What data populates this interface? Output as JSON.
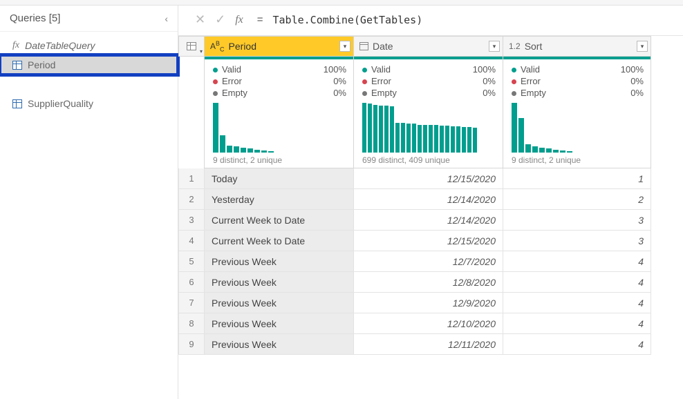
{
  "sidebar": {
    "title": "Queries [5]",
    "items": [
      {
        "label": "DateTableQuery",
        "kind": "fx"
      },
      {
        "label": "Period",
        "kind": "table",
        "selected": true,
        "highlighted": true
      },
      {
        "label": "SupplierQuality",
        "kind": "table"
      }
    ]
  },
  "formula": {
    "eq": "=",
    "text": "Table.Combine(GetTables)"
  },
  "columns": [
    {
      "name": "Period",
      "type": "ABC",
      "selected": true,
      "distinct": "9 distinct, 2 unique"
    },
    {
      "name": "Date",
      "type": "date",
      "distinct": "699 distinct, 409 unique"
    },
    {
      "name": "Sort",
      "type": "1.2",
      "distinct": "9 distinct, 2 unique"
    }
  ],
  "quality": {
    "valid_label": "Valid",
    "valid_pct": "100%",
    "error_label": "Error",
    "error_pct": "0%",
    "empty_label": "Empty",
    "empty_pct": "0%"
  },
  "chart_data": [
    {
      "type": "bar",
      "title": "Period distribution",
      "values": [
        100,
        35,
        14,
        12,
        10,
        8,
        6,
        4,
        3
      ]
    },
    {
      "type": "bar",
      "title": "Date distribution",
      "values": [
        100,
        98,
        96,
        95,
        94,
        93,
        60,
        60,
        58,
        58,
        56,
        56,
        55,
        55,
        54,
        54,
        53,
        53,
        52,
        52,
        50
      ]
    },
    {
      "type": "bar",
      "title": "Sort distribution",
      "values": [
        100,
        70,
        16,
        12,
        10,
        8,
        6,
        4,
        3
      ]
    }
  ],
  "rows": [
    {
      "n": "1",
      "period": "Today",
      "date": "12/15/2020",
      "sort": "1"
    },
    {
      "n": "2",
      "period": "Yesterday",
      "date": "12/14/2020",
      "sort": "2"
    },
    {
      "n": "3",
      "period": "Current Week to Date",
      "date": "12/14/2020",
      "sort": "3"
    },
    {
      "n": "4",
      "period": "Current Week to Date",
      "date": "12/15/2020",
      "sort": "3"
    },
    {
      "n": "5",
      "period": "Previous Week",
      "date": "12/7/2020",
      "sort": "4"
    },
    {
      "n": "6",
      "period": "Previous Week",
      "date": "12/8/2020",
      "sort": "4"
    },
    {
      "n": "7",
      "period": "Previous Week",
      "date": "12/9/2020",
      "sort": "4"
    },
    {
      "n": "8",
      "period": "Previous Week",
      "date": "12/10/2020",
      "sort": "4"
    },
    {
      "n": "9",
      "period": "Previous Week",
      "date": "12/11/2020",
      "sort": "4"
    }
  ]
}
